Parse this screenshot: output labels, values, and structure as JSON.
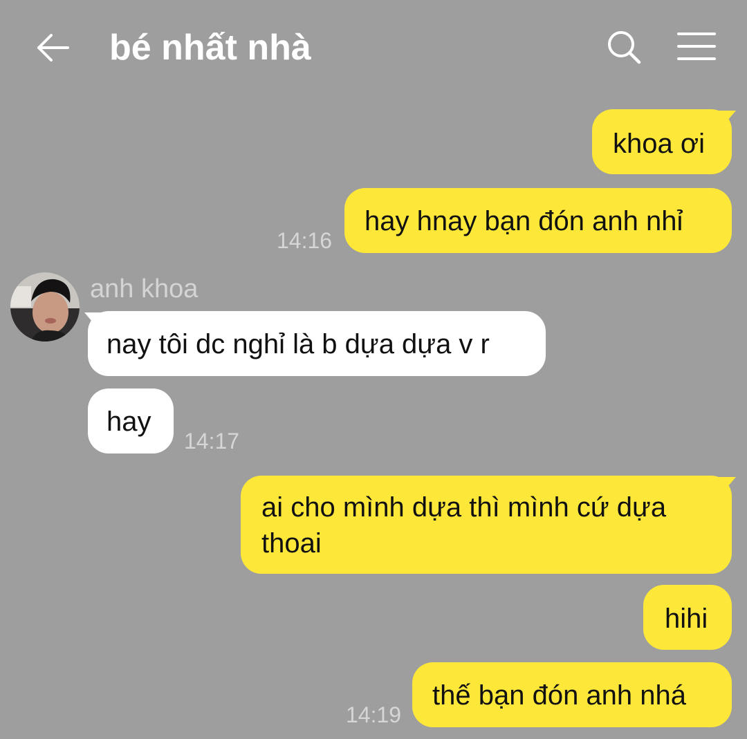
{
  "header": {
    "title": "bé nhất nhà",
    "back_icon": "arrow-left-icon",
    "search_icon": "search-icon",
    "menu_icon": "hamburger-menu-icon"
  },
  "colors": {
    "background": "#9e9e9e",
    "outgoing_bubble": "#fde83a",
    "incoming_bubble": "#ffffff",
    "timestamp": "#d6d6d6"
  },
  "conversation": {
    "sender_name": "anh khoa",
    "messages": [
      {
        "direction": "out",
        "text": "khoa ơi"
      },
      {
        "direction": "out",
        "text": "hay hnay bạn đón anh nhỉ",
        "time": "14:16"
      },
      {
        "direction": "in",
        "text": "nay tôi dc nghỉ là b dựa dựa v r"
      },
      {
        "direction": "in",
        "text": "hay",
        "time": "14:17"
      },
      {
        "direction": "out",
        "text_line1": "ai cho mình dựa thì mình cứ dựa",
        "text_line2": "thoai"
      },
      {
        "direction": "out",
        "text": "hihi"
      },
      {
        "direction": "out",
        "text": "thế bạn đón anh nhá",
        "time": "14:19"
      }
    ]
  }
}
